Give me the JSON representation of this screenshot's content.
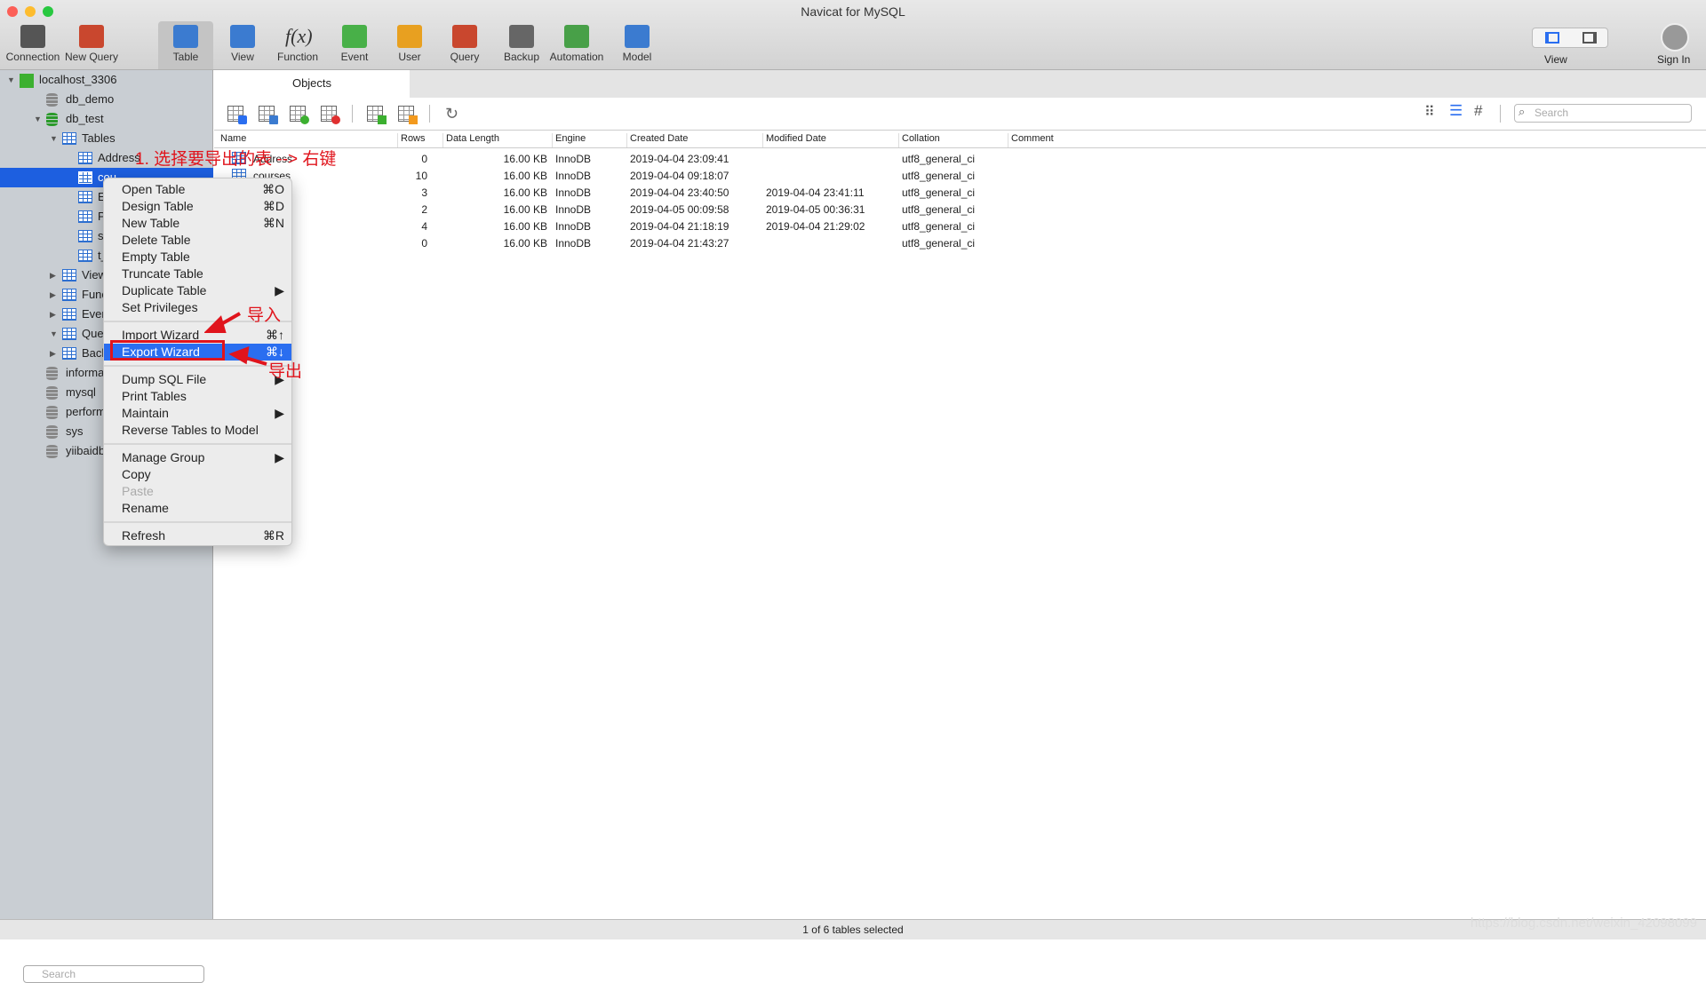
{
  "window": {
    "title": "Navicat for MySQL"
  },
  "toolbar": [
    {
      "label": "Connection",
      "icon": "connection-icon"
    },
    {
      "label": "New Query",
      "icon": "new-query-icon"
    },
    {
      "label": "Table",
      "icon": "table-icon",
      "selected": true
    },
    {
      "label": "View",
      "icon": "view-icon"
    },
    {
      "label": "Function",
      "icon": "function-icon"
    },
    {
      "label": "Event",
      "icon": "event-clock-icon"
    },
    {
      "label": "User",
      "icon": "user-icon"
    },
    {
      "label": "Query",
      "icon": "query-icon"
    },
    {
      "label": "Backup",
      "icon": "backup-icon"
    },
    {
      "label": "Automation",
      "icon": "automation-icon"
    },
    {
      "label": "Model",
      "icon": "model-icon"
    }
  ],
  "toolbar_right": {
    "view_label": "View",
    "signin_label": "Sign In"
  },
  "sidebar": {
    "items": [
      "localhost_3306",
      "db_demo",
      "db_test",
      "Tables",
      "Address",
      "cou",
      "Ema",
      "Per",
      "stu",
      "t_cl",
      "Views",
      "Functio",
      "Events",
      "Querie",
      "Backup",
      "informatio",
      "mysql",
      "performar",
      "sys",
      "yiibaidb"
    ],
    "search_placeholder": "Search"
  },
  "main": {
    "tab": "Objects",
    "search_placeholder": "Search",
    "columns": [
      "Name",
      "Rows",
      "Data Length",
      "Engine",
      "Created Date",
      "Modified Date",
      "Collation",
      "Comment"
    ],
    "rows": [
      [
        "Address",
        "0",
        "16.00 KB",
        "InnoDB",
        "2019-04-04 23:09:41",
        "",
        "utf8_general_ci"
      ],
      [
        "courses",
        "10",
        "16.00 KB",
        "InnoDB",
        "2019-04-04 09:18:07",
        "",
        "utf8_general_ci"
      ],
      [
        "",
        "3",
        "16.00 KB",
        "InnoDB",
        "2019-04-04 23:40:50",
        "2019-04-04 23:41:11",
        "utf8_general_ci"
      ],
      [
        "",
        "2",
        "16.00 KB",
        "InnoDB",
        "2019-04-05 00:09:58",
        "2019-04-05 00:36:31",
        "utf8_general_ci"
      ],
      [
        "",
        "4",
        "16.00 KB",
        "InnoDB",
        "2019-04-04 21:18:19",
        "2019-04-04 21:29:02",
        "utf8_general_ci"
      ],
      [
        "",
        "0",
        "16.00 KB",
        "InnoDB",
        "2019-04-04 21:43:27",
        "",
        "utf8_general_ci"
      ]
    ]
  },
  "context_menu": [
    {
      "label": "Open Table",
      "shortcut": "⌘O"
    },
    {
      "label": "Design Table",
      "shortcut": "⌘D"
    },
    {
      "label": "New Table",
      "shortcut": "⌘N"
    },
    {
      "label": "Delete Table",
      "shortcut": ""
    },
    {
      "label": "Empty Table",
      "shortcut": ""
    },
    {
      "label": "Truncate Table",
      "shortcut": ""
    },
    {
      "label": "Duplicate Table",
      "shortcut": "▶"
    },
    {
      "label": "Set Privileges",
      "shortcut": ""
    },
    {
      "label": "Import Wizard",
      "shortcut": "⌘↑"
    },
    {
      "label": "Export Wizard",
      "shortcut": "⌘↓"
    },
    {
      "label": "Dump SQL File",
      "shortcut": "▶"
    },
    {
      "label": "Print Tables",
      "shortcut": ""
    },
    {
      "label": "Maintain",
      "shortcut": "▶"
    },
    {
      "label": "Reverse Tables to Model",
      "shortcut": ""
    },
    {
      "label": "Manage Group",
      "shortcut": "▶"
    },
    {
      "label": "Copy",
      "shortcut": ""
    },
    {
      "label": "Paste",
      "shortcut": ""
    },
    {
      "label": "Rename",
      "shortcut": ""
    },
    {
      "label": "Refresh",
      "shortcut": "⌘R"
    }
  ],
  "annotations": {
    "step1": "1. 选择要导出的表 --> 右键",
    "import": "导入",
    "export": "导出"
  },
  "status": "1 of 6 tables selected",
  "watermark": "https://blog.csdn.net/weixin_42098099",
  "colors": {
    "selection": "#1d5fe0",
    "annotation": "#e0141c",
    "menu_highlight": "#2a6ef0"
  }
}
